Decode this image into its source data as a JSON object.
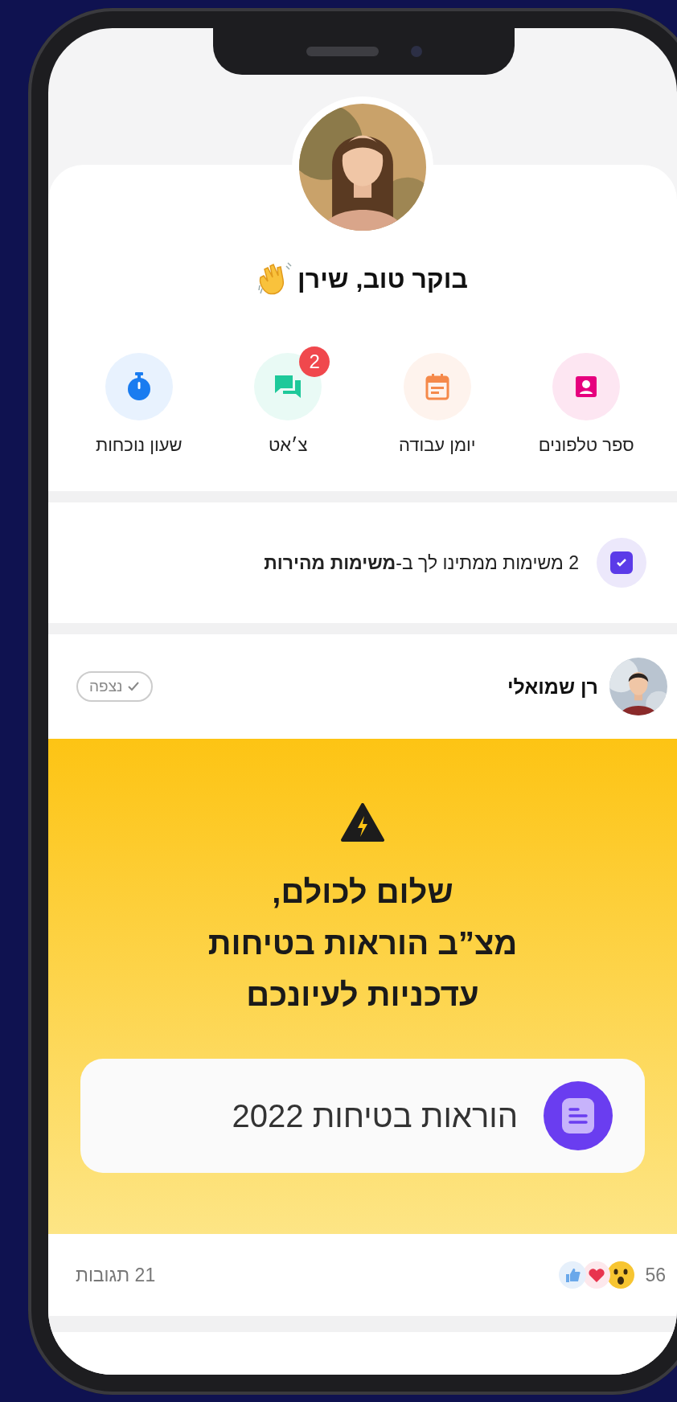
{
  "profile": {
    "greeting": "בוקר טוב, שירן"
  },
  "quick_actions": [
    {
      "label": "ספר טלפונים",
      "kind": "contacts",
      "color": "#e6007e"
    },
    {
      "label": "יומן עבודה",
      "kind": "calendar",
      "color": "#f5894a"
    },
    {
      "label": "צ׳אט",
      "kind": "chat",
      "color": "#1ec99a",
      "badge": "2"
    },
    {
      "label": "שעון נוכחות",
      "kind": "stopwatch",
      "color": "#1a7cf0"
    }
  ],
  "tasks_banner": {
    "text": "2 משימות ממתינו לך ב-**משימות מהירות**",
    "checked": true
  },
  "post": {
    "author": "רן שמואלי",
    "seen_label": "נצפה",
    "headline_lines": [
      "שלום לכולם,",
      "מצ”ב הוראות בטיחות",
      "עדכניות לעיונכם"
    ],
    "attachment": "הוראות בטיחות 2022",
    "reactions_count": "56",
    "comments": "21 תגובות"
  }
}
